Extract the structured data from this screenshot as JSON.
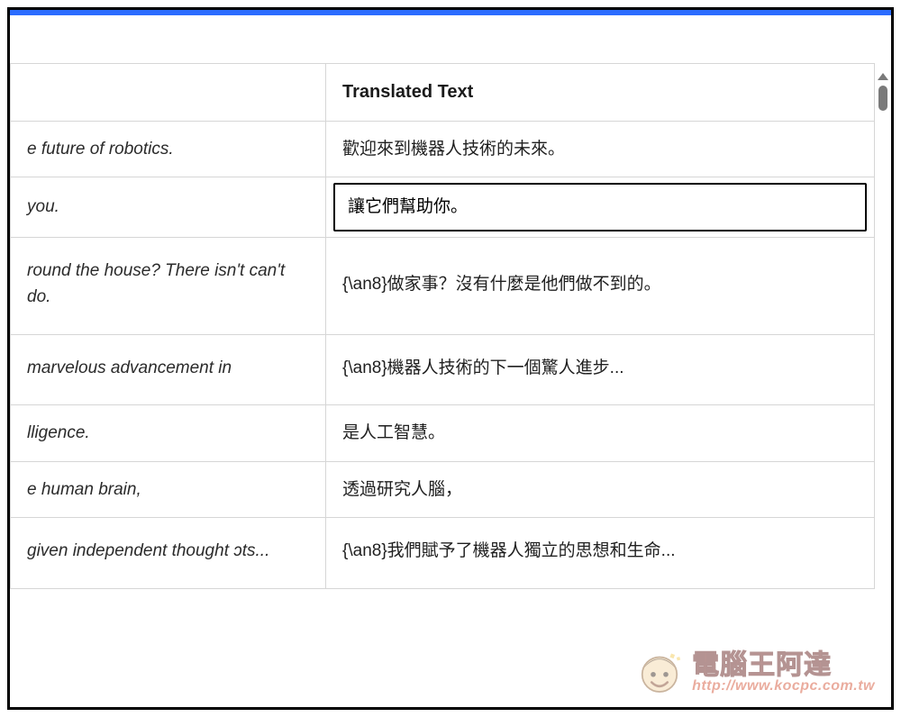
{
  "header": {
    "right_column_title": "Translated Text"
  },
  "rows": [
    {
      "source": "e future of robotics.",
      "translated": "歡迎來到機器人技術的未來。",
      "active": false,
      "tall": false
    },
    {
      "source": "you.",
      "translated": "讓它們幫助你。",
      "active": true,
      "tall": false
    },
    {
      "source": "round the house? There isn't can't do.",
      "translated": "{\\an8}做家事？沒有什麼是他們做不到的。",
      "active": false,
      "tall": true
    },
    {
      "source": " marvelous advancement in",
      "translated": "{\\an8}機器人技術的下一個驚人進步...",
      "active": false,
      "tall": true
    },
    {
      "source": "lligence.",
      "translated": "是人工智慧。",
      "active": false,
      "tall": false
    },
    {
      "source": "e human brain,",
      "translated": "透過研究人腦，",
      "active": false,
      "tall": false
    },
    {
      "source": "given independent thought ɔts...",
      "translated": "{\\an8}我們賦予了機器人獨立的思想和生命...",
      "active": false,
      "tall": true
    }
  ],
  "watermark": {
    "title": "電腦王阿達",
    "url": "http://www.kocpc.com.tw"
  }
}
